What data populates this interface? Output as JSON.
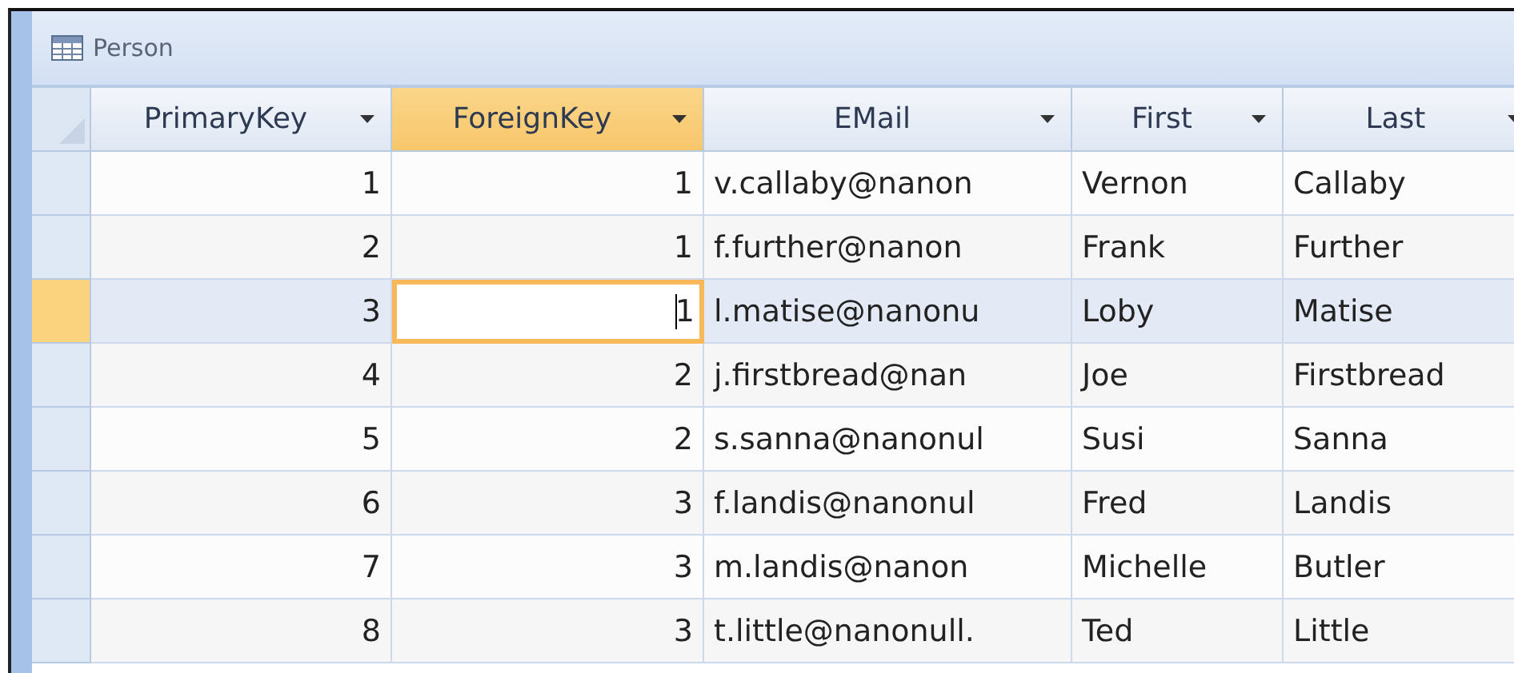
{
  "window": {
    "title": "Person"
  },
  "table": {
    "columns": [
      {
        "label": "PrimaryKey",
        "selected": false,
        "kind": "number"
      },
      {
        "label": "ForeignKey",
        "selected": true,
        "kind": "number"
      },
      {
        "label": "EMail",
        "selected": false,
        "kind": "text"
      },
      {
        "label": "First",
        "selected": false,
        "kind": "text"
      },
      {
        "label": "Last",
        "selected": false,
        "kind": "text"
      }
    ],
    "rows": [
      {
        "selected": false,
        "cells": [
          "1",
          "1",
          "v.callaby@nanon",
          "Vernon",
          "Callaby"
        ]
      },
      {
        "selected": false,
        "cells": [
          "2",
          "1",
          "f.further@nanon",
          "Frank",
          "Further"
        ]
      },
      {
        "selected": true,
        "cells": [
          "3",
          "1",
          "l.matise@nanonu",
          "Loby",
          "Matise"
        ]
      },
      {
        "selected": false,
        "cells": [
          "4",
          "2",
          "j.firstbread@nan",
          "Joe",
          "Firstbread"
        ]
      },
      {
        "selected": false,
        "cells": [
          "5",
          "2",
          "s.sanna@nanonul",
          "Susi",
          "Sanna"
        ]
      },
      {
        "selected": false,
        "cells": [
          "6",
          "3",
          "f.landis@nanonul",
          "Fred",
          "Landis"
        ]
      },
      {
        "selected": false,
        "cells": [
          "7",
          "3",
          "m.landis@nanon",
          "Michelle",
          "Butler"
        ]
      },
      {
        "selected": false,
        "cells": [
          "8",
          "3",
          "t.little@nanonull.",
          "Ted",
          "Little"
        ]
      }
    ]
  }
}
